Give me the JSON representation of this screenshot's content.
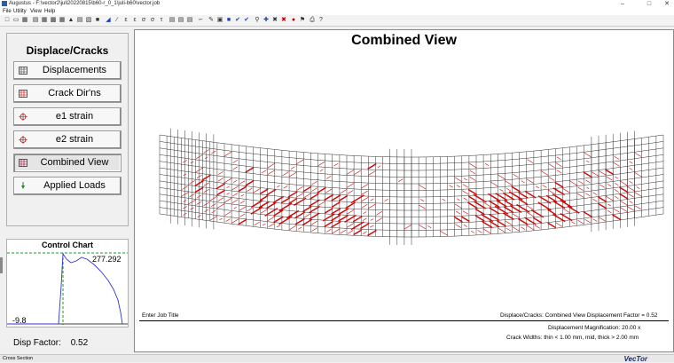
{
  "window": {
    "app_name": "Augustus",
    "title_path": "F:\\vector2\\juli20220815\\b60-r_0_1\\juli-b60\\vector.job"
  },
  "menu": [
    "File",
    "Utility",
    "View",
    "Help"
  ],
  "left_panel": {
    "heading": "Displace/Cracks",
    "buttons": [
      {
        "label": "Displacements",
        "icon": "mesh-icon"
      },
      {
        "label": "Crack Dir'ns",
        "icon": "crack-mesh-icon"
      },
      {
        "label": "e1 strain",
        "icon": "strain-icon"
      },
      {
        "label": "e2 strain",
        "icon": "strain-icon"
      },
      {
        "label": "Combined View",
        "icon": "combined-icon",
        "active": true
      },
      {
        "label": "Applied Loads",
        "icon": "load-arrow-icon"
      }
    ]
  },
  "control_chart": {
    "title": "Control Chart",
    "max_label": "277.292",
    "min_label": "-9.8"
  },
  "disp_factor": {
    "label": "Disp Factor:",
    "value": "0.52"
  },
  "main": {
    "title": "Combined View",
    "job_title": "Enter Job Title",
    "view_info": "Displace/Cracks:  Combined View    Displacement Factor =  0.52",
    "magnification": "Displacement Magnification: 20.00 x",
    "crack_widths": "Crack Widths: thin < 1.00 mm, mid, thick > 2.00 mm"
  },
  "status": {
    "left": "Cross Section",
    "logo": "VecTor"
  },
  "colors": {
    "crack": "#d10000",
    "mesh": "#303030",
    "chart_line": "#3333cc",
    "chart_dash": "#1a9e1a"
  }
}
